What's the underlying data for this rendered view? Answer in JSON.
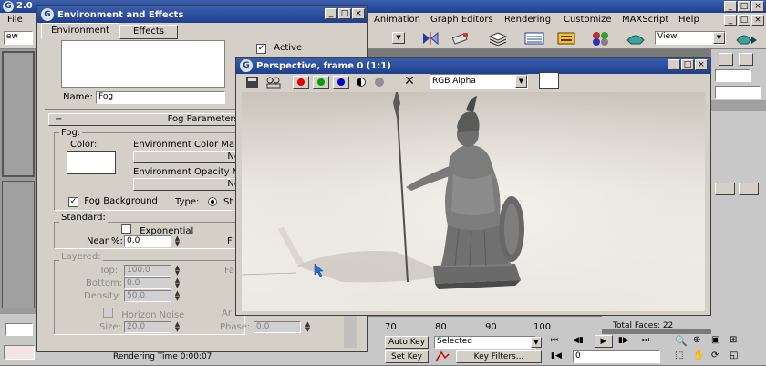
{
  "main": {
    "title_left": "2.0",
    "menu_file": "File",
    "menu_right": [
      "Animation",
      "Graph Editors",
      "Rendering",
      "Customize",
      "MAXScript",
      "Help"
    ],
    "view_label": "View",
    "dropdown_left": "ew",
    "time_ruler": [
      "70",
      "80",
      "90",
      "100"
    ],
    "status_text": "Rendering Time 0:00:07",
    "total_faces": "Total Faces: 22"
  },
  "env": {
    "title": "Environment and Effects",
    "tabs": [
      "Environment",
      "Effects"
    ],
    "active_label": "Active",
    "name_label": "Name:",
    "name_value": "Fog",
    "rollout_title": "Fog Parameters",
    "fog_group": "Fog:",
    "color_label": "Color:",
    "env_color_map": "Environment Color Ma",
    "none1": "No",
    "env_opacity_map": "Environment Opacity M",
    "none2": "No",
    "fog_background": "Fog Background",
    "type_label": "Type:",
    "type_value": "St",
    "standard_group": "Standard:",
    "exponential": "Exponential",
    "near_label": "Near %:",
    "near_value": "0.0",
    "far_label": "F",
    "layered_group": "Layered:",
    "top_label": "Top:",
    "top_value": "100.0",
    "bottom_label": "Bottom:",
    "bottom_value": "0.0",
    "density_label": "Density:",
    "density_value": "50.0",
    "fa_label": "Fa",
    "horizon_noise": "Horizon Noise",
    "ar_label": "Ar",
    "size_label": "Size:",
    "size_value": "20.0",
    "phase_label": "Phase:",
    "phase_value": "0.0"
  },
  "persp": {
    "title": "Perspective, frame 0 (1:1)",
    "channel": "RGB Alpha"
  },
  "bottom": {
    "auto_key": "Auto Key",
    "selected": "Selected",
    "set_key": "Set Key",
    "key_filters": "Key Filters...",
    "frame_value": "0"
  },
  "colors": {
    "titlebar": "#1f3f8c",
    "panel": "#c8c8c8",
    "render_bg": "#e6e1d9"
  }
}
